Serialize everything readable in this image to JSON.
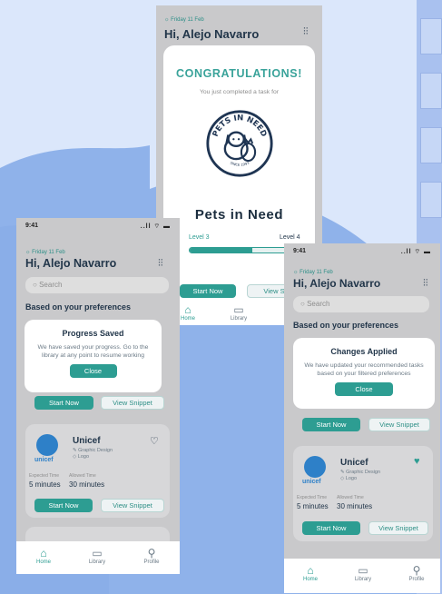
{
  "common": {
    "time": "9:41",
    "status_icons": "..ll ⌔ ▬",
    "date": "Friday 11 Feb",
    "greeting": "Hi, Alejo Navarro",
    "search_placeholder": "Search",
    "preferences_title": "Based on your preferences",
    "start_now": "Start Now",
    "view_snippet": "View Snippet",
    "start_now_short": "Start Now",
    "view_snippet_short": "View Snip",
    "nav": {
      "home": "Home",
      "library": "Library",
      "profile": "Profile"
    }
  },
  "congrats_screen": {
    "title": "CONGRATULATIONS!",
    "subtitle": "You just completed a task for",
    "emblem_text": "PETS IN NEED",
    "emblem_since": "SINCE 1993",
    "org_name": "Pets in Need",
    "level_current": "Level 3",
    "level_next": "Level 4",
    "progress": 0.5
  },
  "progress_modal": {
    "title": "Progress Saved",
    "body": "We have saved your progress. Go to the library at any point to resume working",
    "button": "Close"
  },
  "changes_modal": {
    "title": "Changes Applied",
    "body": "We have updated your recommended tasks based on your filtered preferences",
    "button": "Close"
  },
  "unicef_card": {
    "name": "Unicef",
    "logo_word": "unicef",
    "tags": [
      "Graphic Design",
      "Logo"
    ],
    "expected_label": "Expected Time",
    "expected_value": "5 minutes",
    "allowed_label": "Allowed Time",
    "allowed_value": "30 minutes"
  },
  "colors": {
    "accent": "#2d9d92",
    "dark_text": "#22364a",
    "heart_filled": "#2d9d92"
  }
}
